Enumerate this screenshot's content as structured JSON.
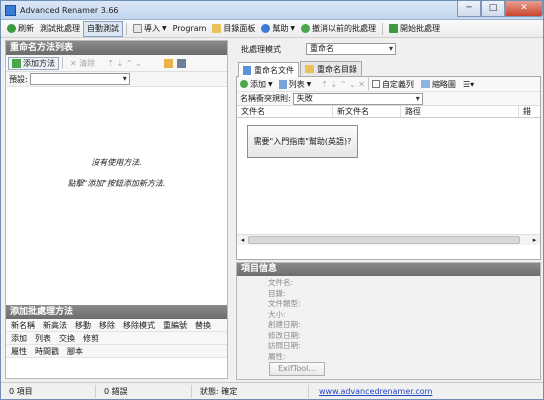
{
  "window": {
    "title": "Advanced Renamer 3.66",
    "controls": [
      "─",
      "□",
      "✕"
    ]
  },
  "toolbar": {
    "refresh": "刷新",
    "test_batch": "測試批處理",
    "auto_test": "自動測試",
    "import": "導入",
    "program": "Program",
    "target_panel": "目錄面板",
    "help": "幫助",
    "undo": "撤消以前的批處理",
    "start": "開始批處理"
  },
  "left_pane": {
    "title": "重命名方法列表",
    "add_method": "添加方法",
    "remove": "清除",
    "preset_label": "預設:",
    "preset_value": "",
    "empty_line1": "沒有使用方法.",
    "empty_line2": "點擊\"添加\"按鈕添加新方法."
  },
  "add_process": {
    "title": "添加批處理方法",
    "row1": [
      "新名稱",
      "新高法",
      "移動",
      "移除",
      "移除模式",
      "重編號",
      "替換"
    ],
    "row2": [
      "添加",
      "列表",
      "交換",
      "修剪"
    ],
    "row3": [
      "屬性",
      "時間戳",
      "腳本"
    ]
  },
  "batch_mode": {
    "label": "批處理模式",
    "value": "重命名"
  },
  "tabs": [
    {
      "label": "重命名文件"
    },
    {
      "label": "重命名目錄"
    }
  ],
  "file_toolbar": {
    "add": "添加",
    "list": "列表",
    "custom_cols": "自定義列",
    "thumbnails": "縮略圖"
  },
  "conflict": {
    "label": "名稱衝突規則:",
    "value": "失敗"
  },
  "grid_columns": [
    "文件名",
    "新文件名",
    "路徑",
    "錯"
  ],
  "help_popup": "需要\"入門指南\"幫助(英語)?",
  "info": {
    "title": "項目信息",
    "fields": [
      "文件名:",
      "目錄:",
      "文件類型:",
      "大小:",
      "創建日期:",
      "修改日期:",
      "訪問日期:",
      "屬性:"
    ],
    "exif_button": "ExifTool..."
  },
  "status": {
    "items": "0 項目",
    "errors": "0 錯誤",
    "state": "狀態: 確定",
    "url": "www.advancedrenamer.com"
  },
  "colors": {
    "accent": "#3a7bd5",
    "header": "#7a7a7a",
    "link": "#2247c4"
  }
}
